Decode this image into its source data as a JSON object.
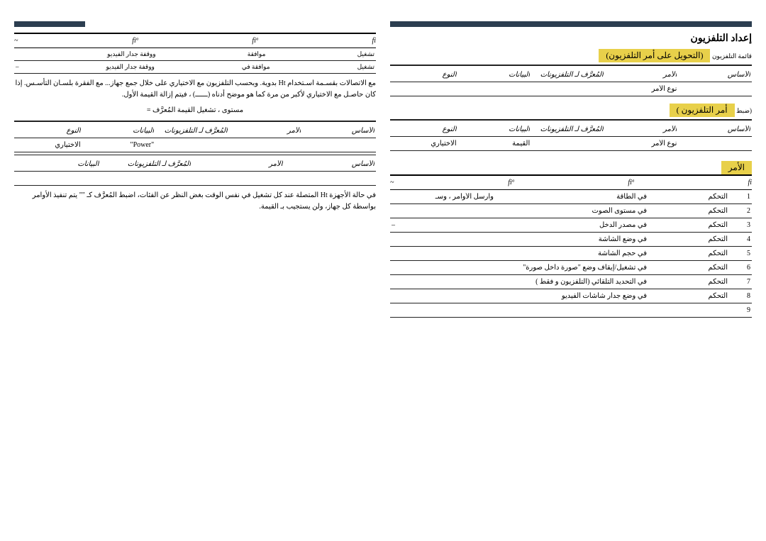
{
  "right": {
    "title_main": "إعداد التلفزيون",
    "sec1_label": "قائمة التلفزيون",
    "sec1_hl": "(التحويل على أمر التلفزيون)",
    "tbl1": {
      "h": [
        "الأساس",
        "الأمر",
        "المُعرَّف لـ التلفزيونات",
        "البيانات",
        "النوع"
      ],
      "r": [
        "",
        "نوع الأمر",
        "",
        "",
        ""
      ]
    },
    "sec2_label": "(ضبط",
    "sec2_hl": "أمر التلفزيون )",
    "tbl2": {
      "h": [
        "الأساس",
        "الأمر",
        "المُعرَّف لـ التلفزيونات",
        "البيانات",
        "النوع"
      ],
      "r": [
        "",
        "نوع الأمر",
        "",
        "القيمة",
        "الاختياري"
      ]
    },
    "cmds_label": "الأمر",
    "cmds_header": [
      "fi",
      "fiª",
      "fiª",
      "~"
    ],
    "cmds": [
      {
        "n": "1",
        "a": "التحكم",
        "b": "في الطاقة",
        "c": "وأرسل الأوامر ، وسـ",
        "d": ""
      },
      {
        "n": "2",
        "a": "التحكم",
        "b": "في مستوى الصوت",
        "c": "",
        "d": ""
      },
      {
        "n": "3",
        "a": "التحكم",
        "b": "في مصدر الدخل",
        "c": "",
        "d": "–"
      },
      {
        "n": "4",
        "a": "التحكم",
        "b": "في وضع الشاشة",
        "c": "",
        "d": ""
      },
      {
        "n": "5",
        "a": "التحكم",
        "b": "في حجم الشاشة",
        "c": "",
        "d": ""
      },
      {
        "n": "6",
        "a": "التحكم",
        "b": "في تشغيل/إيقاف وضع \"صورة داخل صورة\"",
        "c": "",
        "d": ""
      },
      {
        "n": "7",
        "a": "التحكم",
        "b": "في التحديد التلقائي (التلفزيون و فقط )",
        "c": "",
        "d": ""
      },
      {
        "n": "8",
        "a": "التحكم",
        "b": "في وضع جدار شاشات الفيديو",
        "c": "",
        "d": ""
      },
      {
        "n": "9",
        "a": "",
        "b": "",
        "c": "",
        "d": ""
      }
    ]
  },
  "left": {
    "hdr": [
      "fi",
      "fiª",
      "fiª",
      "~"
    ],
    "sr1": [
      "تشغيل",
      "موافقة",
      "ووقفة جدار الفيديو",
      ""
    ],
    "sr2": [
      "تشغيل",
      "موافقة في",
      "ووقفة جدار الفيديو",
      "–"
    ],
    "para1": "مع الاتصالات بقسـمة اسـتخدام Ht بدوية. وبحسب التلفزيون مع الاختياري على خلال جمع جهاز... مع الفقرة بلسـان التأسـس. إذا كان حاصـل مع الاختياري لأكبر من مرة كما هو موضح أدناه (ــــــ) ، فيتم إزالة القيمة الأول.",
    "formula": "مستوى ، تشغيل القيمة المُعرَّف =",
    "tbl3": {
      "h": [
        "الأساس",
        "الأمر",
        "المُعرَّف لـ التلفزيونات",
        "البيانات",
        "النوع"
      ],
      "r1": [
        "",
        "",
        "",
        "\"Power\"",
        "الاختياري"
      ],
      "h2": [
        "الأساس",
        "الأمر",
        "المُعرَّف لـ التلفزيونات",
        "البيانات"
      ]
    },
    "para2": "في حالة الأجهزة Ht المتصلة عند كل تشغيل في نفس الوقت بغض النظر عن الفئات، اضبط المُعرَّف كـ \"\" يتم تنفيذ الأوامر بواسطة كل جهاز، ولن يستجيب بـ القيمة."
  }
}
